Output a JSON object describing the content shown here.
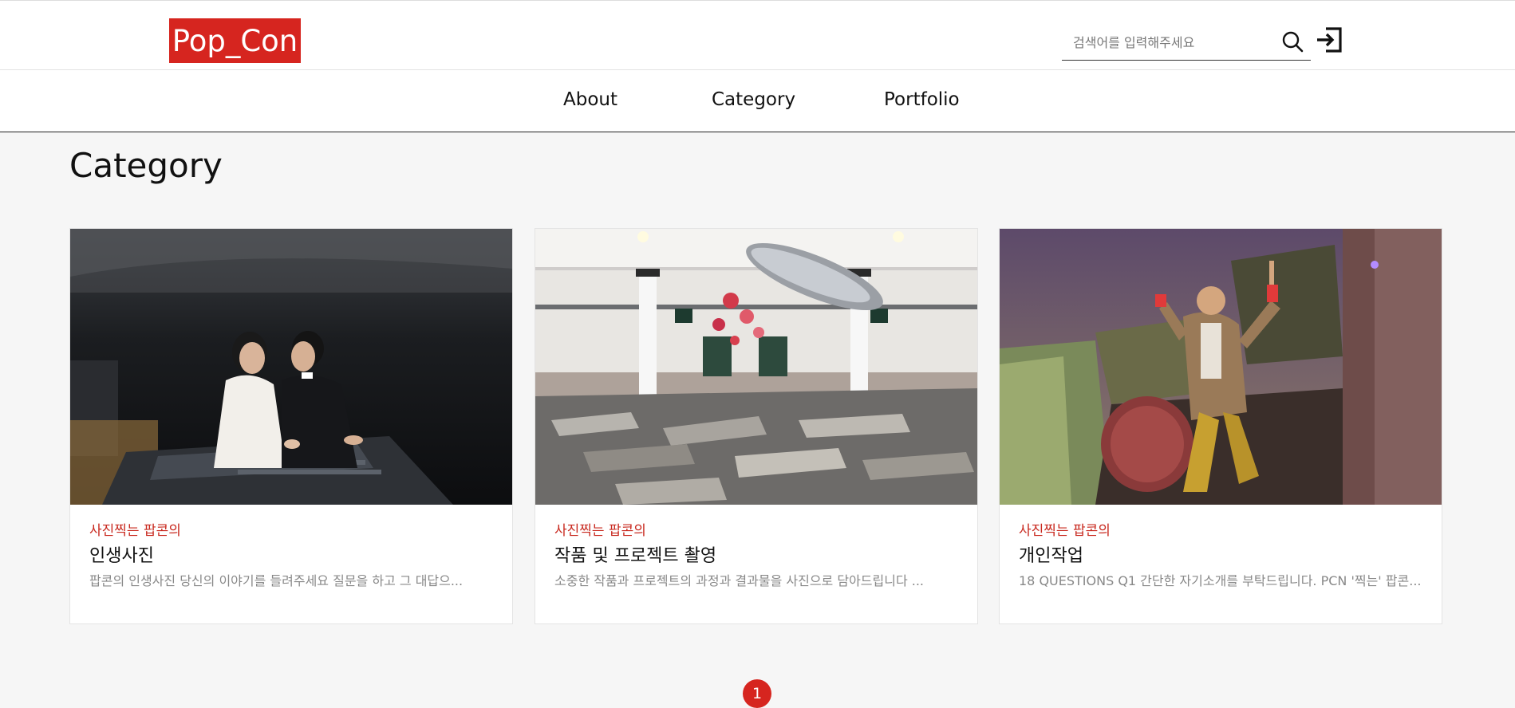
{
  "header": {
    "logo_text": "Pop_Con",
    "search": {
      "placeholder": "검색어를 입력해주세요",
      "value": ""
    },
    "icons": {
      "search": "search-icon",
      "login": "login-icon"
    },
    "brand_color": "#d6251f"
  },
  "nav": {
    "items": [
      {
        "label": "About"
      },
      {
        "label": "Category"
      },
      {
        "label": "Portfolio"
      }
    ]
  },
  "main": {
    "title": "Category",
    "cards": [
      {
        "tag": "사진찍는 팝콘의",
        "title": "인생사진",
        "desc": "팝콘의 인생사진 당신의 이야기를 들려주세요   질문을 하고  그 대답으..."
      },
      {
        "tag": "사진찍는 팝콘의",
        "title": "작품 및 프로젝트 촬영",
        "desc": " 소중한 작품과 프로젝트의  과정과 결과물을  사진으로 담아드립니다   ..."
      },
      {
        "tag": "사진찍는 팝콘의",
        "title": "개인작업",
        "desc": "18 QUESTIONS  Q1 간단한 자기소개를 부탁드립니다.  PCN  '찍는' 팝콘..."
      }
    ]
  },
  "pagination": {
    "current": "1"
  }
}
